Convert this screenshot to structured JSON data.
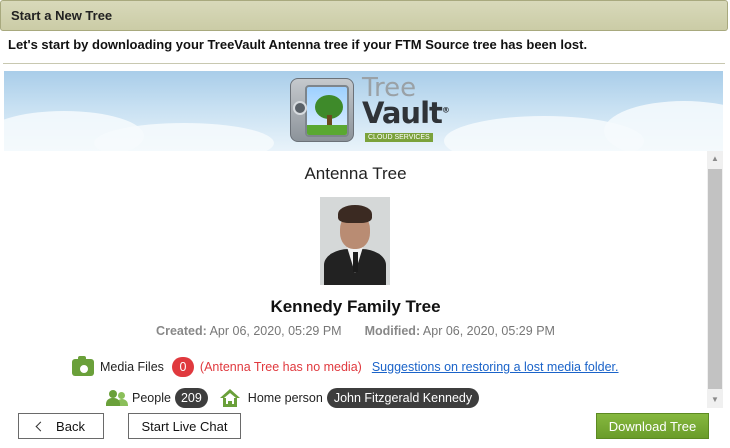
{
  "window": {
    "title": "Start a New Tree"
  },
  "instruction": "Let's start by downloading your TreeVault Antenna tree if your FTM Source tree has been lost.",
  "logo": {
    "word1": "Tree",
    "word2": "Vault",
    "tm": "®",
    "tagline": "CLOUD SERVICES"
  },
  "tree": {
    "heading": "Antenna Tree",
    "name": "Kennedy Family Tree",
    "created_label": "Created:",
    "created_value": "Apr 06, 2020, 05:29 PM",
    "modified_label": "Modified:",
    "modified_value": "Apr 06, 2020, 05:29 PM"
  },
  "media": {
    "label": "Media Files",
    "count": "0",
    "note": "(Antenna Tree has no media)",
    "link": "Suggestions on restoring a lost media folder."
  },
  "people": {
    "label": "People",
    "count": "209",
    "home_label": "Home person",
    "home_person": "John Fitzgerald Kennedy"
  },
  "buttons": {
    "back": "Back",
    "live_chat": "Start Live Chat",
    "download": "Download Tree"
  },
  "colors": {
    "accent_green": "#6aa03a",
    "badge_red": "#e0393e",
    "link_blue": "#1a63c9",
    "titlebar": "#cbcca6"
  }
}
